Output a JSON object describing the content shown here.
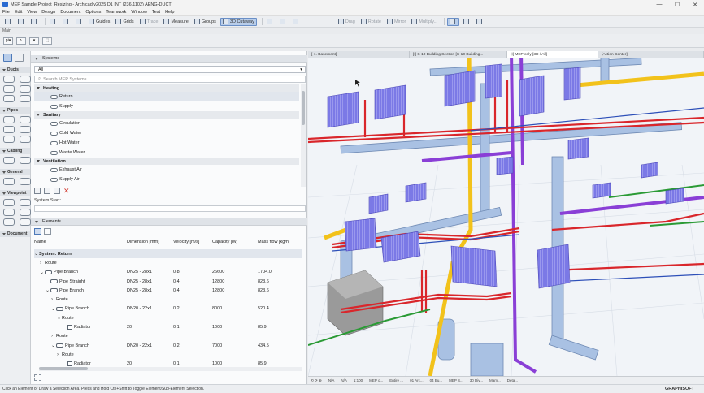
{
  "window": {
    "title": "MEP Sample Project_Resizing - Archicad v2025 D1 INT (236.1102) AENG-DUCT",
    "controls": [
      "—",
      "☐",
      "✕"
    ]
  },
  "menu": [
    "File",
    "Edit",
    "View",
    "Design",
    "Document",
    "Options",
    "Teamwork",
    "Window",
    "Test",
    "Help"
  ],
  "toolbar": {
    "guides": "Guides",
    "grids": "Grids",
    "trace": "Trace",
    "measure": "Measure",
    "groups": "Groups",
    "cutaway": "3D Cutaway",
    "drag": "Drag",
    "rotate": "Rotate",
    "mirror": "Mirror",
    "multiply": "Multiply..."
  },
  "infobox": {
    "label": "Main"
  },
  "systems": {
    "header": "Systems",
    "filter": "All",
    "search_placeholder": "Search MEP Systems",
    "groups": [
      {
        "name": "Heating",
        "items": [
          "Return",
          "Supply"
        ]
      },
      {
        "name": "Sanitary",
        "items": [
          "Circulation",
          "Cold Water",
          "Hot Water",
          "Waste Water"
        ]
      },
      {
        "name": "Ventilation",
        "items": [
          "Exhaust Air",
          "Supply Air"
        ]
      }
    ],
    "system_start": "System Start:"
  },
  "elements": {
    "header": "Elements",
    "columns": [
      "Name",
      "Dimension [mm]",
      "Velocity [m/s]",
      "Capacity [W]",
      "Mass flow [kg/h]"
    ],
    "rows": [
      {
        "name": "System: Return",
        "dim": "",
        "vel": "",
        "cap": "",
        "flow": ""
      },
      {
        "name": "Route",
        "dim": "",
        "vel": "",
        "cap": "",
        "flow": ""
      },
      {
        "name": "Pipe Branch",
        "dim": "DN25 - 28x1",
        "vel": "0.8",
        "cap": "26600",
        "flow": "1704.0"
      },
      {
        "name": "Pipe Straight",
        "dim": "DN25 - 28x1",
        "vel": "0.4",
        "cap": "12800",
        "flow": "823.6"
      },
      {
        "name": "Pipe Branch",
        "dim": "DN25 - 28x1",
        "vel": "0.4",
        "cap": "12800",
        "flow": "823.6"
      },
      {
        "name": "Route",
        "dim": "",
        "vel": "",
        "cap": "",
        "flow": ""
      },
      {
        "name": "Pipe Branch",
        "dim": "DN20 - 22x1",
        "vel": "0.2",
        "cap": "8000",
        "flow": "520.4"
      },
      {
        "name": "Route",
        "dim": "",
        "vel": "",
        "cap": "",
        "flow": ""
      },
      {
        "name": "Radiator",
        "dim": "20",
        "vel": "0.1",
        "cap": "1000",
        "flow": "85.9"
      },
      {
        "name": "Route",
        "dim": "",
        "vel": "",
        "cap": "",
        "flow": ""
      },
      {
        "name": "Pipe Branch",
        "dim": "DN20 - 22x1",
        "vel": "0.2",
        "cap": "7000",
        "flow": "434.5"
      },
      {
        "name": "Route",
        "dim": "",
        "vel": "",
        "cap": "",
        "flow": ""
      },
      {
        "name": "Radiator",
        "dim": "20",
        "vel": "0.1",
        "cap": "1000",
        "flow": "85.9"
      }
    ]
  },
  "toolbox": {
    "sections": [
      "Ducts",
      "Pipes",
      "Cabling",
      "General",
      "Viewpoint",
      "Document"
    ]
  },
  "viewport_tabs": [
    "[-1. Basement]",
    "[I] S-10 Building Section [S-10 Building...",
    "[I] MEP only [3D / All]",
    "[Action Center]"
  ],
  "bottombar": [
    "N/A",
    "N/A",
    "1:100",
    "MEP o...",
    "Entire ...",
    "01 Arc...",
    "04 Bu...",
    "MEP S...",
    "30 Div...",
    "Mam...",
    "Deta..."
  ],
  "status": "Click an Element or Draw a Selection Area. Press and Hold Ctrl+Shift to Toggle Element/Sub-Element Selection.",
  "brand": "GRAPHISOFT",
  "colors": {
    "heating_red": "#d9262b",
    "supply_purple": "#8a3fd6",
    "ventilation_blue": "#9fb8dc",
    "sanitary_green": "#2a9a35",
    "yellow_pipe": "#f2c21b",
    "radiator": "#7b79e6"
  }
}
